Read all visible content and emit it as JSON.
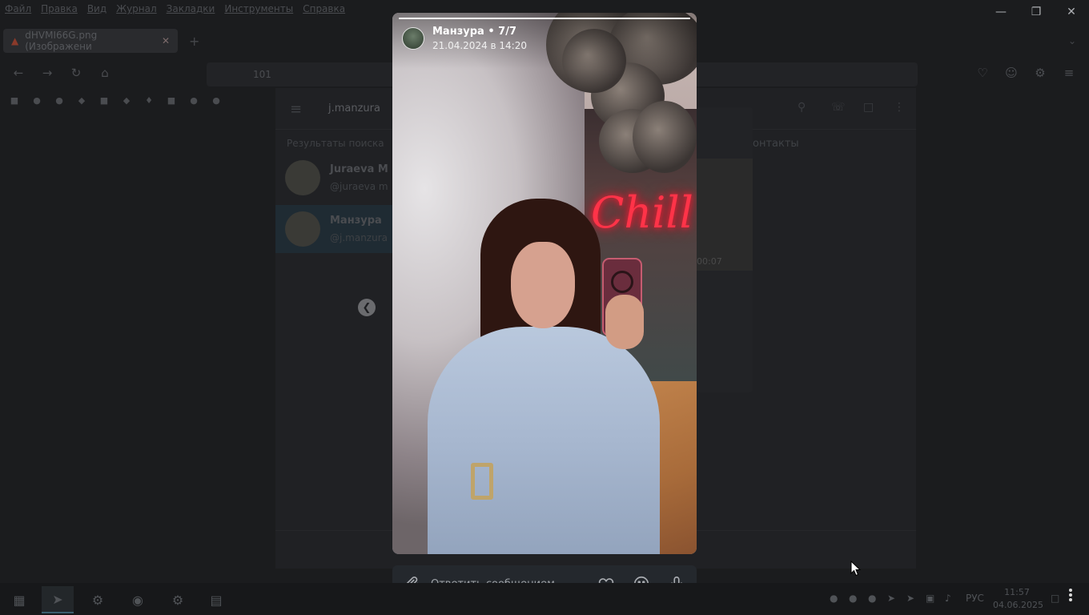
{
  "browser": {
    "menu": [
      "Файл",
      "Правка",
      "Вид",
      "Журнал",
      "Закладки",
      "Инструменты",
      "Справка"
    ],
    "tab_title": "dHVMI66G.png (Изображени",
    "url_text": "101"
  },
  "telegram_bg": {
    "search_text": "j.manzura",
    "results_label": "Результаты поиска",
    "chats": [
      {
        "name": "Juraeva M",
        "sub": "@juraeva m"
      },
      {
        "name": "Манзура",
        "sub": "@j.manzura"
      }
    ],
    "contacts_label": "онтакты",
    "thumb_time": "00:07"
  },
  "story": {
    "author": "Манзура • 7/7",
    "date": "21.04.2024 в 14:20",
    "progress": 1.0,
    "neon_text": "Chill"
  },
  "reply": {
    "placeholder": "Ответить сообщением..."
  },
  "taskbar": {
    "language": "РУС",
    "time": "11:57",
    "date": "04.06.2025"
  },
  "icons": {
    "attach": "paperclip-icon",
    "like": "heart-icon",
    "emoji": "emoji-icon",
    "voice": "microphone-icon"
  }
}
